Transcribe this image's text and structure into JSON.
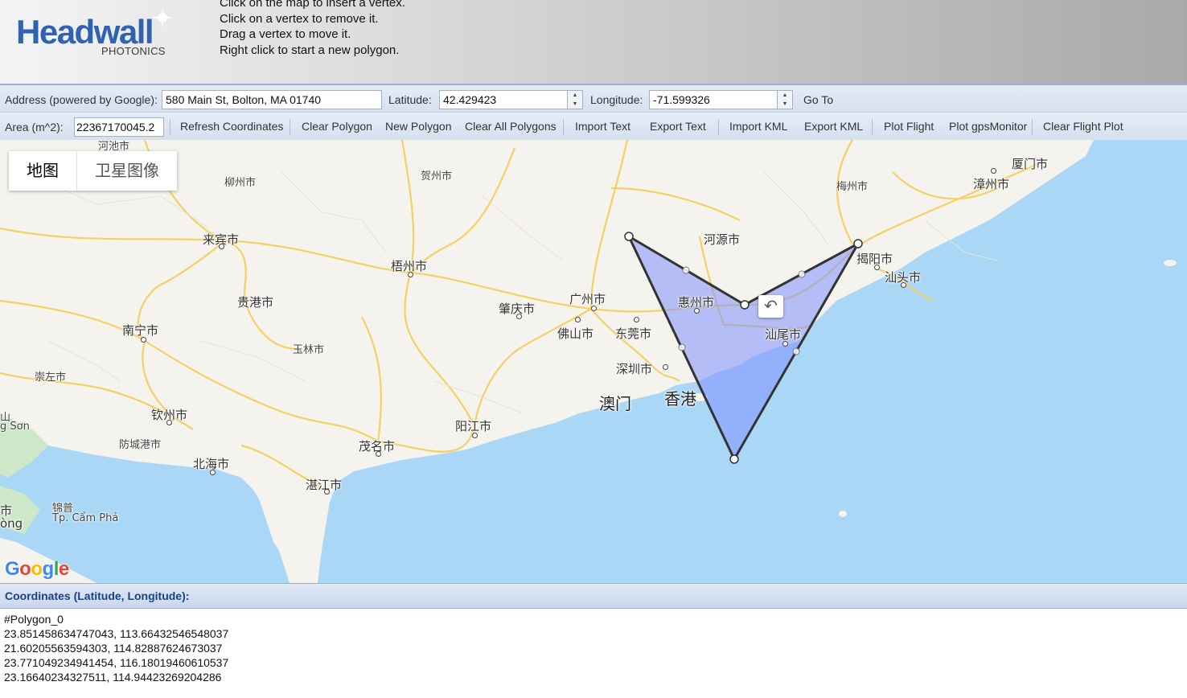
{
  "header": {
    "logo_text": "Headwall",
    "logo_subtext": "PHOTONICS",
    "instructions": [
      "Click on the map to insert a vertex.",
      "Click on a vertex to remove it.",
      "Drag a vertex to move it.",
      "Right click to start a new polygon."
    ]
  },
  "address_bar": {
    "address_label": "Address (powered by Google):",
    "address_value": "580 Main St, Bolton, MA 01740",
    "latitude_label": "Latitude:",
    "latitude_value": "42.429423",
    "longitude_label": "Longitude:",
    "longitude_value": "-71.599326",
    "goto_label": "Go To"
  },
  "toolbar": {
    "area_label": "Area (m^2):",
    "area_value": "22367170045.2",
    "buttons": [
      "Refresh Coordinates",
      "Clear Polygon",
      "New Polygon",
      "Clear All Polygons",
      "Import Text",
      "Export Text",
      "Import KML",
      "Export KML",
      "Plot Flight",
      "Plot gpsMonitor",
      "Clear Flight Plot"
    ]
  },
  "map": {
    "type_buttons": [
      "地图",
      "卫星图像"
    ],
    "google_logo": "Google",
    "undo_icon": "undo-arrow-icon",
    "cities": {
      "hechi": "河池市",
      "hezhou": "贺州市",
      "liuzhou": "柳州市",
      "meizhou": "梅州市",
      "xiamen": "厦门市",
      "zhangzhou": "漳州市",
      "laibin": "来宾市",
      "heyuan": "河源市",
      "jieyang": "揭阳市",
      "shantou": "汕头市",
      "wuzhou": "梧州市",
      "guangzhou": "广州市",
      "huizhou": "惠州市",
      "zhaoqing": "肇庆市",
      "guigang": "贵港市",
      "nanning": "南宁市",
      "foshan": "佛山市",
      "dongguan": "东莞市",
      "shanwei": "汕尾市",
      "yulin": "玉林市",
      "shenzhen": "深圳市",
      "chongzuo": "崇左市",
      "macau": "澳门",
      "hongkong": "香港",
      "qinzhou": "钦州市",
      "yangjiang": "阳江市",
      "fangchenggang": "防城港市",
      "maoming": "茂名市",
      "beihai": "北海市",
      "zhanjiang": "湛江市",
      "langson": "g Sơn",
      "campha_cn": "锦普",
      "campha": "Tp. Cẩm Phả",
      "edge_shi": "市",
      "edge_ong": "òng",
      "edge_shan": "山"
    },
    "colors": {
      "sea": "#a9d7f5",
      "land": "#f5f3ee",
      "polygon_fill": "#8090ff",
      "polygon_stroke": "#333333"
    }
  },
  "coordinates": {
    "title": "Coordinates (Latitude, Longitude):",
    "lines": [
      "#Polygon_0",
      "23.851458634747043, 113.66432546548037",
      "21.60205563594303, 114.82887624673037",
      "23.771049234941454, 116.18019460610537",
      "23.16640234327511, 114.94423269204286"
    ]
  }
}
